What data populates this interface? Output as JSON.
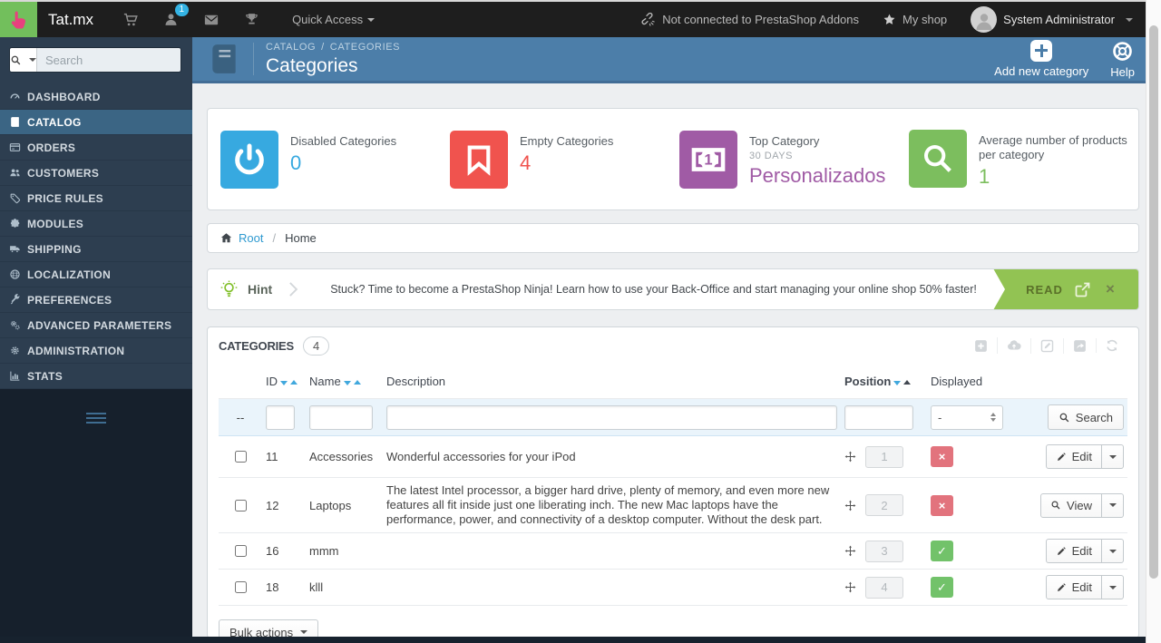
{
  "topbar": {
    "brand": "Tat.mx",
    "badge": "1",
    "icons": [
      "cart-icon",
      "customers-icon",
      "messages-icon",
      "trophy-icon"
    ],
    "quick_access": "Quick Access",
    "addons_status": "Not connected to PrestaShop Addons",
    "my_shop": "My shop",
    "user": "System Administrator"
  },
  "sidebar": {
    "search_placeholder": "Search",
    "items": [
      {
        "label": "DASHBOARD",
        "icon": "gauge-icon"
      },
      {
        "label": "CATALOG",
        "icon": "book-icon",
        "active": true
      },
      {
        "label": "ORDERS",
        "icon": "credit-card-icon"
      },
      {
        "label": "CUSTOMERS",
        "icon": "users-icon"
      },
      {
        "label": "PRICE RULES",
        "icon": "tag-icon"
      },
      {
        "label": "MODULES",
        "icon": "puzzle-icon"
      },
      {
        "label": "SHIPPING",
        "icon": "truck-icon"
      },
      {
        "label": "LOCALIZATION",
        "icon": "globe-icon"
      },
      {
        "label": "PREFERENCES",
        "icon": "wrench-icon"
      },
      {
        "label": "ADVANCED PARAMETERS",
        "icon": "gears-icon"
      },
      {
        "label": "ADMINISTRATION",
        "icon": "gear-icon"
      },
      {
        "label": "STATS",
        "icon": "bar-chart-icon"
      }
    ]
  },
  "header": {
    "breadcrumb": {
      "section": "CATALOG",
      "sep": "/",
      "page": "CATEGORIES"
    },
    "title": "Categories",
    "add_new": "Add new category",
    "help": "Help"
  },
  "kpis": [
    {
      "title": "Disabled Categories",
      "value": "0",
      "color": "#37a9e0",
      "icon": "power-icon"
    },
    {
      "title": "Empty Categories",
      "value": "4",
      "color": "#f0534e",
      "icon": "bookmark-icon"
    },
    {
      "title": "Top Category",
      "subtitle": "30 DAYS",
      "value": "Personalizados",
      "color": "#a05ba5",
      "icon": "banknote-icon"
    },
    {
      "title": "Average number of products per category",
      "value": "1",
      "color": "#7cbe5e",
      "icon": "magnifier-icon"
    }
  ],
  "path": {
    "root": "Root",
    "sep": "/",
    "current": "Home"
  },
  "hint": {
    "label": "Hint",
    "text": "Stuck? Time to become a PrestaShop Ninja! Learn how to use your Back-Office and start managing your online shop 50% faster!",
    "read": "READ",
    "read_color": "#92c353"
  },
  "panel": {
    "title": "CATEGORIES",
    "count": "4",
    "toolbar_icons": [
      "add-icon",
      "import-icon",
      "edit-list-icon",
      "export-icon",
      "refresh-icon"
    ],
    "columns": {
      "id": "ID",
      "name": "Name",
      "description": "Description",
      "position": "Position",
      "displayed": "Displayed"
    },
    "filter": {
      "dash": "--",
      "select_value": "-",
      "search_label": "Search"
    },
    "rows": [
      {
        "id": "11",
        "name": "Accessories",
        "description": "Wonderful accessories for your iPod",
        "position": "1",
        "displayed": false,
        "status_glyph": "×",
        "action_label": "Edit"
      },
      {
        "id": "12",
        "name": "Laptops",
        "description": "The latest Intel processor, a bigger hard drive, plenty of memory, and even more new features all fit inside just one liberating inch. The new Mac laptops have the performance, power, and connectivity of a desktop computer. Without the desk part.",
        "position": "2",
        "displayed": false,
        "status_glyph": "×",
        "action_label": "View"
      },
      {
        "id": "16",
        "name": "mmm",
        "description": "",
        "position": "3",
        "displayed": true,
        "status_glyph": "✓",
        "action_label": "Edit"
      },
      {
        "id": "18",
        "name": "klll",
        "description": "",
        "position": "4",
        "displayed": true,
        "status_glyph": "✓",
        "action_label": "Edit"
      }
    ],
    "bulk_label": "Bulk actions"
  },
  "colors": {
    "header_blue": "#4c7ea9",
    "sidebar_active": "#3b6584",
    "link_blue": "#2f9ad0",
    "success_green": "#72c26a",
    "danger_red": "#e2737d"
  }
}
